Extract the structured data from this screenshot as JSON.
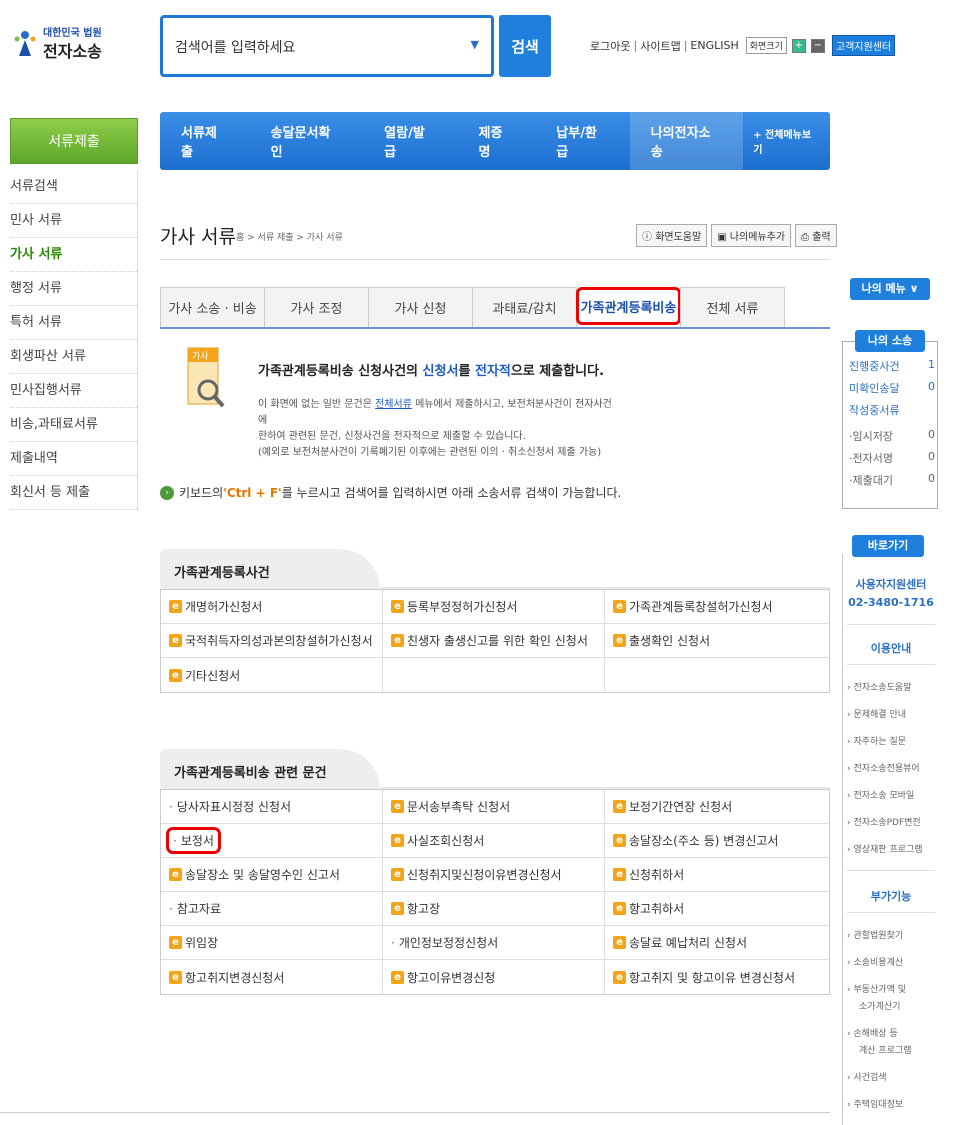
{
  "header": {
    "logo_top": "대한민국 법원",
    "logo_main": "전자소송",
    "search_placeholder": "검색어를 입력하세요",
    "search_button": "검색",
    "links": [
      "로그아웃",
      "사이트맵",
      "ENGLISH"
    ],
    "font_size_label": "화면크기",
    "plus": "+",
    "minus": "−",
    "support": "고객지원센터"
  },
  "menu": {
    "items": [
      "서류제출",
      "송달문서확인",
      "열람/발급",
      "제증명",
      "납부/환급",
      "나의전자소송"
    ],
    "all": "+ 전체메뉴보기"
  },
  "sidebar": {
    "head": "서류제출",
    "items": [
      "서류검색",
      "민사 서류",
      "가사 서류",
      "행정 서류",
      "특허 서류",
      "회생파산 서류",
      "민사집행서류",
      "비송,과태료서류",
      "제출내역",
      "회신서 등 제출"
    ]
  },
  "page": {
    "title": "가사 서류",
    "breadcrumb": "홈 > 서류 제출 > 가사 서류",
    "btn_help": "화면도움말",
    "btn_mymenu": "나의메뉴추가",
    "btn_print": "출력"
  },
  "tabs": [
    "가사 소송 · 비송",
    "가사 조정",
    "가사 신청",
    "과태료/감치",
    "가족관계등록비송",
    "전체 서류"
  ],
  "info": {
    "icon_label": "가사",
    "heading_pre": "가족관계등록비송 신청사건의 ",
    "heading_hl1": "신청서",
    "heading_mid": "를 ",
    "heading_hl2": "전자적",
    "heading_post": "으로 제출합니다.",
    "line1_pre": "이 화면에 없는 일반 문건은 ",
    "line1_link": "전체서류",
    "line1_post": " 메뉴에서 제출하시고, 보전처분사건이 전자사건에",
    "line2": "한하여 관련된 문건, 신청사건을 전자적으로 제출할 수 있습니다.",
    "line3": "(예외로 보전처분사건이 기록폐기된 이후에는 관련된 이의 · 취소신청서 제출 가능)"
  },
  "keyboard_tip": {
    "pre": "키보드의 ",
    "key": "'Ctrl + F'",
    "post": "를 누르시고 검색어를 입력하시면 아래 소송서류 검색이 가능합니다."
  },
  "section1": {
    "title": "가족관계등록사건",
    "rows": [
      [
        "개명허가신청서",
        "등록부정정허가신청서",
        "가족관계등록창설허가신청서"
      ],
      [
        "국적취득자의성과본의창설허가신청서",
        "친생자 출생신고를 위한 확인 신청서",
        "출생확인 신청서"
      ],
      [
        "기타신청서",
        "",
        ""
      ]
    ]
  },
  "section2": {
    "title": "가족관계등록비송 관련 문건",
    "rows": [
      [
        "당사자표시정정 신청서",
        "문서송부촉탁 신청서",
        "보정기간연장 신청서"
      ],
      [
        "보정서",
        "사실조회신청서",
        "송달장소(주소 등) 변경신고서"
      ],
      [
        "송달장소 및 송달영수인 신고서",
        "신청취지및신청이유변경신청서",
        "신청취하서"
      ],
      [
        "참고자료",
        "항고장",
        "항고취하서"
      ],
      [
        "위임장",
        "개인정보정정신청서",
        "송달료 예납처리 신청서"
      ],
      [
        "항고취지변경신청서",
        "항고이유변경신청",
        "항고취지 및 항고이유 변경신청서"
      ]
    ]
  },
  "right": {
    "my_menu": "나의 메뉴 ∨",
    "my_case": "나의 소송",
    "stats": [
      {
        "label": "진행중사건",
        "value": "1"
      },
      {
        "label": "미확인송달",
        "value": "0"
      },
      {
        "label": "작성중서류",
        "value": ""
      },
      {
        "label": "·임시저장",
        "value": "0"
      },
      {
        "label": "·전자서명",
        "value": "0"
      },
      {
        "label": "·제출대기",
        "value": "0"
      }
    ],
    "shortcut": "바로가기",
    "support_title": "사용자지원센터",
    "support_phone": "02-3480-1716",
    "guide_title": "이용안내",
    "guide_links": [
      "› 전자소송도움말",
      "› 문제해결 안내",
      "› 자주하는 질문",
      "› 전자소송전용뷰어",
      "› 전자소송 모바일",
      "› 전자소송PDF변전",
      "› 영상재판 프로그램"
    ],
    "extra_title": "부가기능",
    "extra_links": [
      "› 관할법원찾기",
      "› 소송비용계산",
      "› 부동산가액 및",
      "소가계산기",
      "› 손해배상 등",
      "계산 프로그램",
      "› 사건검색",
      "› 주택임대정보"
    ]
  }
}
